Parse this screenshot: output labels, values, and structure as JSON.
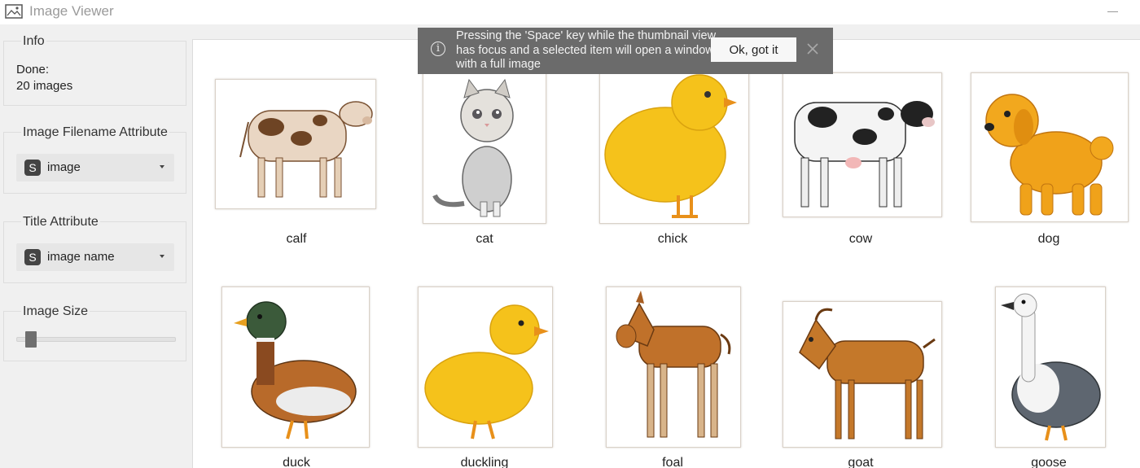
{
  "window": {
    "title": "Image Viewer"
  },
  "sidebar": {
    "info": {
      "title": "Info",
      "status": "Done:",
      "count": "20 images"
    },
    "filename_attr": {
      "title": "Image Filename Attribute",
      "badge": "S",
      "value": "image"
    },
    "title_attr": {
      "title": "Title Attribute",
      "badge": "S",
      "value": "image name"
    },
    "image_size": {
      "title": "Image Size",
      "value_fraction": 0.06
    }
  },
  "notification": {
    "text": "Pressing the 'Space' key while the thumbnail view has focus and a selected item will open a window with a full image",
    "ok_label": "Ok, got it"
  },
  "thumbnails": [
    {
      "label": "calf",
      "icon": "calf-image"
    },
    {
      "label": "cat",
      "icon": "cat-image"
    },
    {
      "label": "chick",
      "icon": "chick-image"
    },
    {
      "label": "cow",
      "icon": "cow-image"
    },
    {
      "label": "dog",
      "icon": "dog-image"
    },
    {
      "label": "duck",
      "icon": "duck-image"
    },
    {
      "label": "duckling",
      "icon": "duckling-image"
    },
    {
      "label": "foal",
      "icon": "foal-image"
    },
    {
      "label": "goat",
      "icon": "goat-image"
    },
    {
      "label": "goose",
      "icon": "goose-image"
    }
  ],
  "colors": {
    "notification_bg": "#6b6b6b",
    "chick_yellow": "#f5c21b",
    "brown": "#b5651d"
  }
}
